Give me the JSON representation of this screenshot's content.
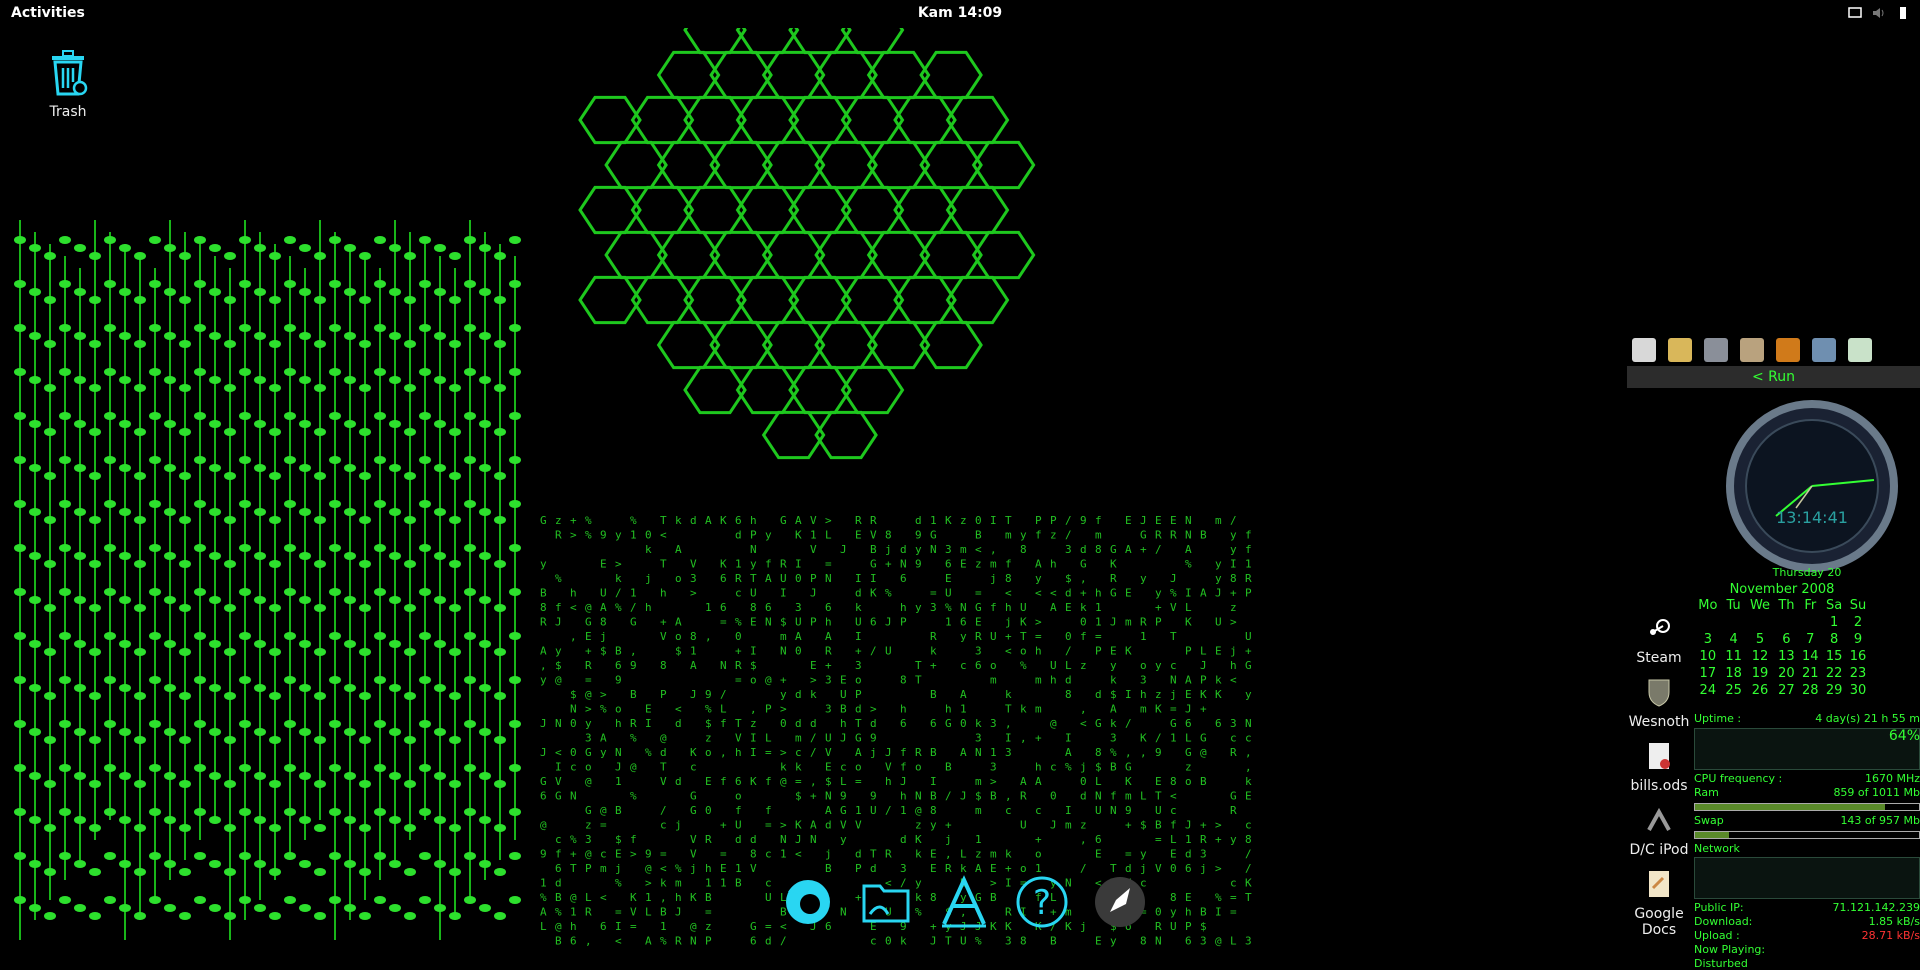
{
  "topbar": {
    "activities_label": "Activities",
    "clock_text": "Kam 14:09",
    "tray_icons": [
      "screen-icon",
      "volume-icon",
      "battery-icon"
    ]
  },
  "desktop": {
    "trash_label": "Trash",
    "wallpaper": "green circuit board, hexagon grid and falling matrix characters"
  },
  "dock": {
    "items": [
      {
        "icon": "firefox-icon"
      },
      {
        "icon": "files-icon"
      },
      {
        "icon": "software-center-icon"
      },
      {
        "icon": "help-icon"
      },
      {
        "icon": "launcher-rocket-icon"
      }
    ]
  },
  "right_panel": {
    "launcher_icons": [
      "terminal-icon",
      "notes-icon",
      "settings-icon",
      "tools-icon",
      "close-x-icon",
      "penguin-icon",
      "display-icon"
    ],
    "run_label": "< Run",
    "clock_time": "13:14:41",
    "clock_day": "Thursday 20",
    "calendar": {
      "month": "November 2008",
      "weekdays": [
        "Mo",
        "Tu",
        "We",
        "Th",
        "Fr",
        "Sa",
        "Su"
      ],
      "weeks": [
        [
          "",
          "",
          "",
          "",
          "",
          "1",
          "2"
        ],
        [
          "3",
          "4",
          "5",
          "6",
          "7",
          "8",
          "9"
        ],
        [
          "10",
          "11",
          "12",
          "13",
          "14",
          "15",
          "16"
        ],
        [
          "17",
          "18",
          "19",
          "20",
          "21",
          "22",
          "23"
        ],
        [
          "24",
          "25",
          "26",
          "27",
          "28",
          "29",
          "30"
        ]
      ]
    },
    "uptime_label": "Uptime :",
    "uptime_value": "4 day(s) 21 h 55 m",
    "cpu_percent": "64%",
    "cpu_freq_label": "CPU frequency :",
    "cpu_freq_value": "1670 MHz",
    "ram_label": "Ram",
    "ram_value": "859 of 1011 Mb",
    "ram_fraction": 0.85,
    "swap_label": "Swap",
    "swap_value": "143 of 957 Mb",
    "swap_fraction": 0.15,
    "network_label": "Network",
    "public_ip_label": "Public IP:",
    "public_ip_value": "71.121.142.239",
    "download_label": "Download:",
    "download_value": "1.85 kB/s",
    "upload_label": "Upload :",
    "upload_value": "28.71 kB/s",
    "now_playing_label": "Now Playing:",
    "now_playing_value": "Disturbed"
  },
  "side_apps": [
    {
      "label": "Steam",
      "icon": "steam-icon"
    },
    {
      "label": "Wesnoth",
      "icon": "wesnoth-shield-icon"
    },
    {
      "label": "bills.ods",
      "icon": "spreadsheet-icon"
    },
    {
      "label": "D/C iPod",
      "icon": "ipod-icon"
    },
    {
      "label": "Google Docs",
      "icon": "google-docs-icon"
    }
  ]
}
